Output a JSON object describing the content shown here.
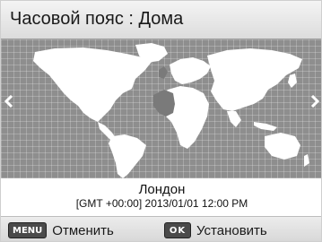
{
  "header": {
    "title": "Часовой пояс : Дома"
  },
  "map": {
    "prev_icon": "chevron-left-icon",
    "next_icon": "chevron-right-icon",
    "selected_zone": "GMT +00:00"
  },
  "info": {
    "city": "Лондон",
    "datetime": "[GMT +00:00] 2013/01/01 12:00 PM"
  },
  "footer": {
    "cancel_key": "MENU",
    "cancel_label": "Отменить",
    "set_key": "OK",
    "set_label": "Установить"
  },
  "colors": {
    "map_background": "#8e8e8e",
    "land": "#ffffff",
    "selected_zone": "#7a7a7a"
  }
}
